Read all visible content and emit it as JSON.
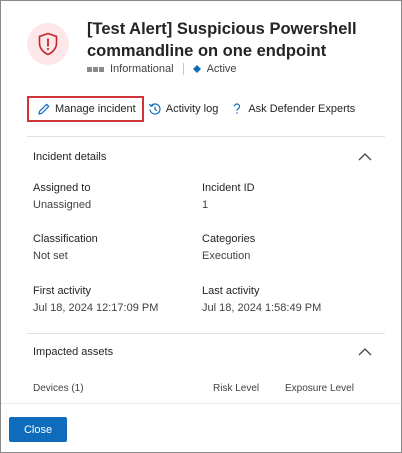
{
  "header": {
    "title": "[Test Alert] Suspicious Powershell commandline on one endpoint",
    "severity": "Informational",
    "status": "Active",
    "status_color": "#0f6cbd",
    "alert_icon": "shield-alert-icon"
  },
  "actions": {
    "manage_incident": "Manage incident",
    "activity_log": "Activity log",
    "ask_experts": "Ask Defender Experts"
  },
  "incident_details": {
    "heading": "Incident details",
    "fields": [
      {
        "label": "Assigned to",
        "value": "Unassigned"
      },
      {
        "label": "Incident ID",
        "value": "1"
      },
      {
        "label": "Classification",
        "value": "Not set"
      },
      {
        "label": "Categories",
        "value": "Execution"
      },
      {
        "label": "First activity",
        "value": "Jul 18, 2024 12:17:09 PM"
      },
      {
        "label": "Last activity",
        "value": "Jul 18, 2024 1:58:49 PM"
      }
    ]
  },
  "impacted_assets": {
    "heading": "Impacted assets",
    "columns": [
      "Devices (1)",
      "Risk Level",
      "Exposure Level"
    ]
  },
  "footer": {
    "close_label": "Close",
    "accent": "#0f6cbd"
  }
}
